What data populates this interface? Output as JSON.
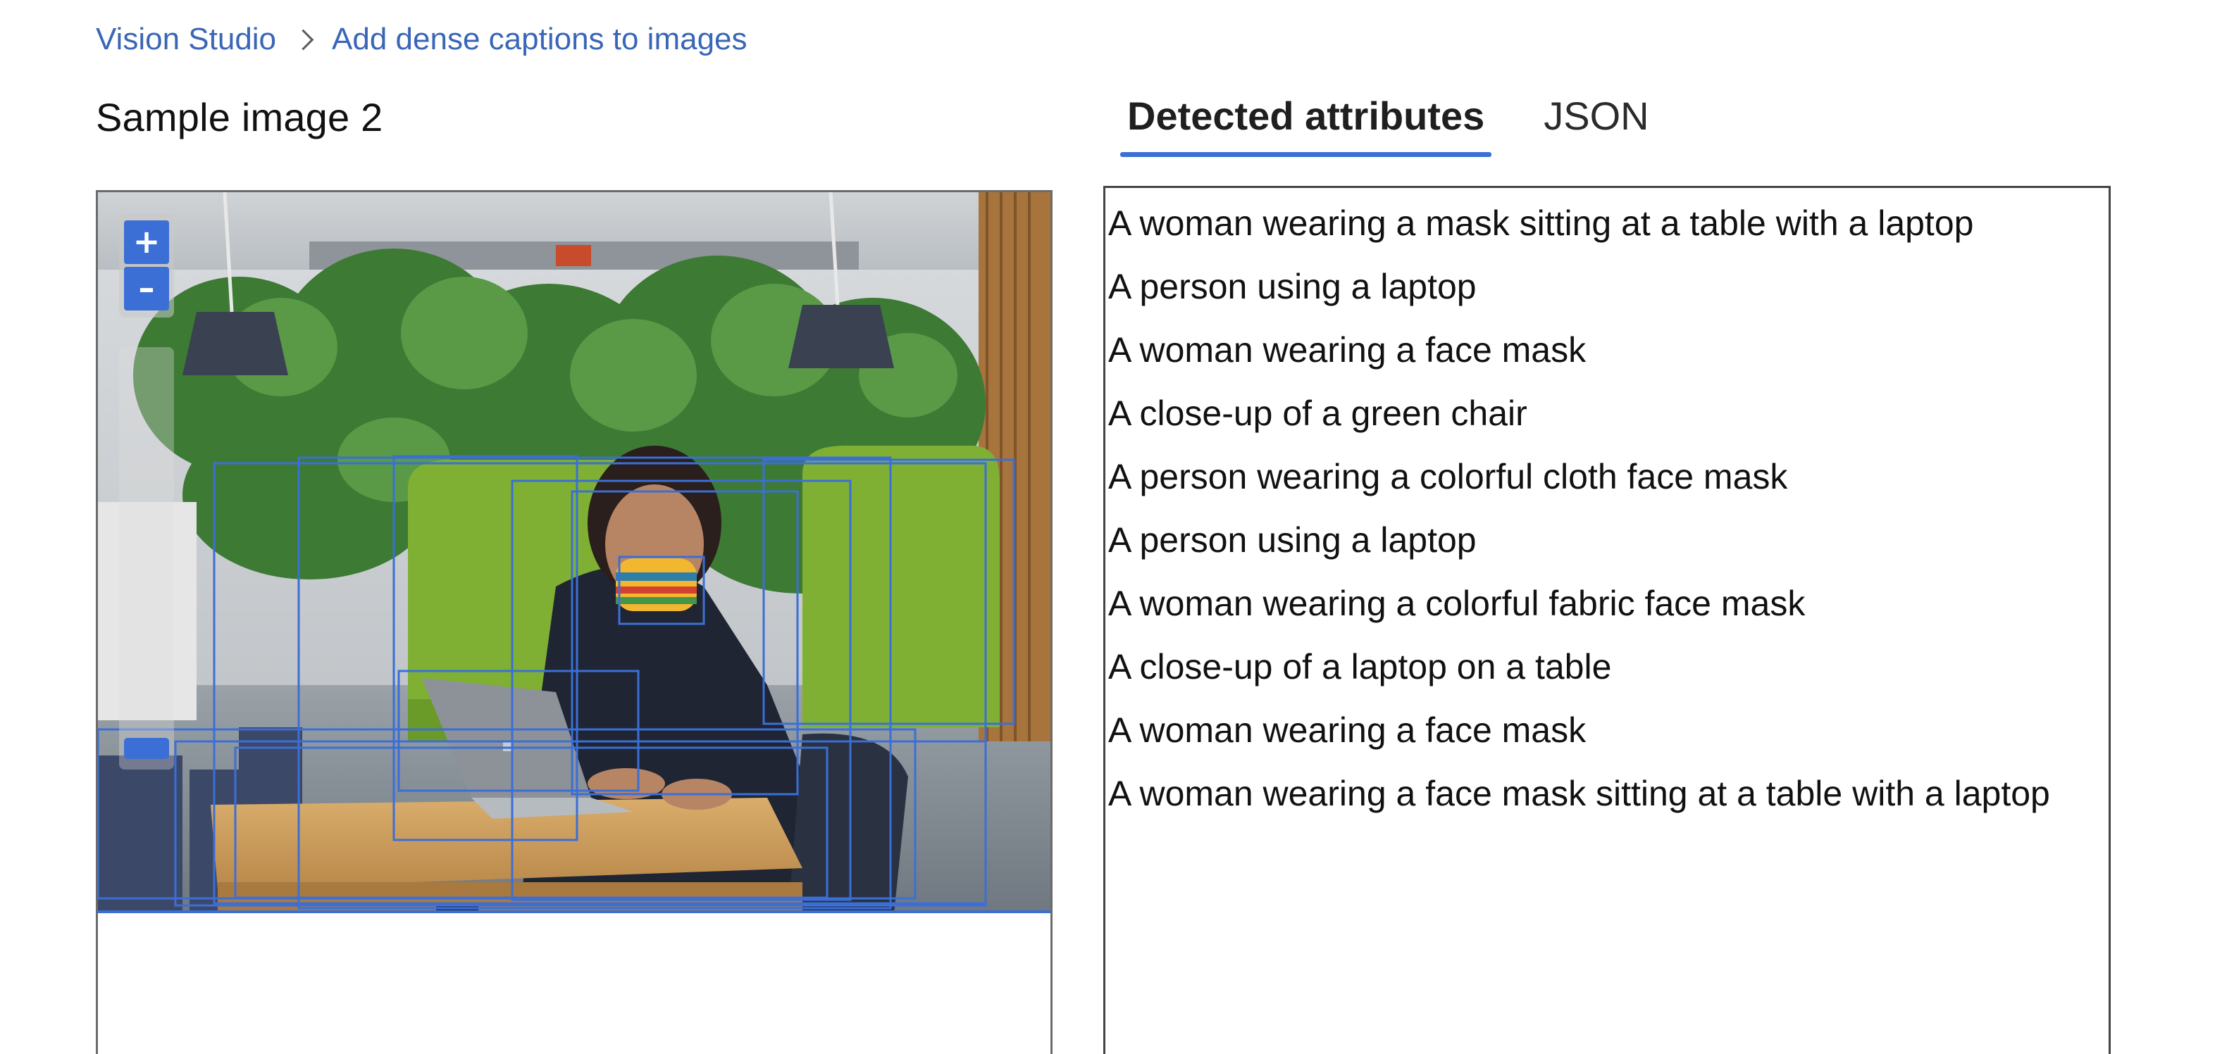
{
  "breadcrumb": {
    "root": "Vision Studio",
    "current": "Add dense captions to images"
  },
  "image_panel": {
    "title": "Sample image 2",
    "zoom_in_label": "+",
    "zoom_out_label": "–",
    "bounding_box_color": "#3b6fd6"
  },
  "tabs": [
    {
      "label": "Detected attributes",
      "active": true
    },
    {
      "label": "JSON",
      "active": false
    }
  ],
  "captions": [
    "A woman wearing a mask sitting at a table with a laptop",
    "A person using a laptop",
    "A woman wearing a face mask",
    "A close-up of a green chair",
    "A person wearing a colorful cloth face mask",
    "A person using a laptop",
    "A woman wearing a colorful fabric face mask",
    "A close-up of a laptop on a table",
    "A woman wearing a face mask",
    "A woman wearing a face mask sitting at a table with a laptop"
  ],
  "colors": {
    "accent": "#3b6fd6",
    "link": "#3a66b8"
  },
  "icons": {
    "breadcrumb_separator": "chevron-right-icon"
  }
}
